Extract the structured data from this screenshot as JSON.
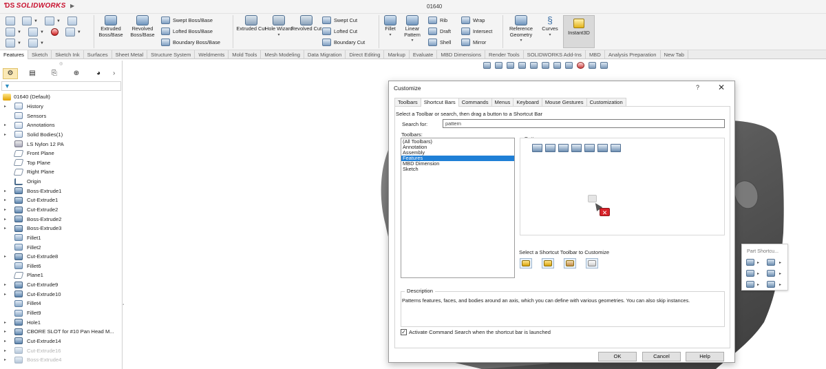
{
  "app": {
    "logo_text": "SOLIDWORKS",
    "doc_title": "01640"
  },
  "cmd": {
    "extruded_boss": "Extruded Boss/Base",
    "revolved_boss": "Revolved Boss/Base",
    "swept_boss": "Swept Boss/Base",
    "lofted_boss": "Lofted Boss/Base",
    "boundary_boss": "Boundary Boss/Base",
    "extruded_cut": "Extruded Cut",
    "hole_wizard": "Hole Wizard",
    "revolved_cut": "Revolved Cut",
    "swept_cut": "Swept Cut",
    "lofted_cut": "Lofted Cut",
    "boundary_cut": "Boundary Cut",
    "fillet": "Fillet",
    "linear_pattern": "Linear Pattern",
    "rib": "Rib",
    "draft": "Draft",
    "shell": "Shell",
    "wrap": "Wrap",
    "intersect": "Intersect",
    "mirror": "Mirror",
    "reference_geometry": "Reference Geometry",
    "curves": "Curves",
    "instant3d": "Instant3D"
  },
  "tabs": [
    "Features",
    "Sketch",
    "Sketch Ink",
    "Surfaces",
    "Sheet Metal",
    "Structure System",
    "Weldments",
    "Mold Tools",
    "Mesh Modeling",
    "Data Migration",
    "Direct Editing",
    "Markup",
    "Evaluate",
    "MBD Dimensions",
    "Render Tools",
    "SOLIDWORKS Add-Ins",
    "MBD",
    "Analysis Preparation",
    "New Tab"
  ],
  "tree": {
    "root": "01640  (Default)",
    "items": [
      {
        "label": "History",
        "icon": "history-icon",
        "exp": true
      },
      {
        "label": "Sensors",
        "icon": "sensor-icon",
        "exp": false
      },
      {
        "label": "Annotations",
        "icon": "annotation-icon",
        "exp": true
      },
      {
        "label": "Solid Bodies(1)",
        "icon": "solid-bodies-icon",
        "exp": true
      },
      {
        "label": "LS Nylon 12 PA",
        "icon": "material-icon",
        "exp": false
      },
      {
        "label": "Front Plane",
        "icon": "plane-icon",
        "exp": false
      },
      {
        "label": "Top Plane",
        "icon": "plane-icon",
        "exp": false
      },
      {
        "label": "Right Plane",
        "icon": "plane-icon",
        "exp": false
      },
      {
        "label": "Origin",
        "icon": "origin-icon",
        "exp": false
      },
      {
        "label": "Boss-Extrude1",
        "icon": "boss-extrude-icon",
        "exp": true
      },
      {
        "label": "Cut-Extrude1",
        "icon": "cut-extrude-icon",
        "exp": true
      },
      {
        "label": "Cut-Extrude2",
        "icon": "cut-extrude-icon",
        "exp": true
      },
      {
        "label": "Boss-Extrude2",
        "icon": "boss-extrude-icon",
        "exp": true
      },
      {
        "label": "Boss-Extrude3",
        "icon": "boss-extrude-icon",
        "exp": true
      },
      {
        "label": "Fillet1",
        "icon": "fillet-icon",
        "exp": false
      },
      {
        "label": "Fillet2",
        "icon": "fillet-icon",
        "exp": false
      },
      {
        "label": "Cut-Extrude8",
        "icon": "cut-extrude-icon",
        "exp": true
      },
      {
        "label": "Fillet6",
        "icon": "fillet-icon",
        "exp": false
      },
      {
        "label": "Plane1",
        "icon": "plane-icon",
        "exp": false
      },
      {
        "label": "Cut-Extrude9",
        "icon": "cut-extrude-icon",
        "exp": true
      },
      {
        "label": "Cut-Extrude10",
        "icon": "cut-extrude-icon",
        "exp": true
      },
      {
        "label": "Fillet4",
        "icon": "fillet-icon",
        "exp": false
      },
      {
        "label": "Fillet9",
        "icon": "fillet-icon",
        "exp": false
      },
      {
        "label": "Hole1",
        "icon": "hole-icon",
        "exp": true
      },
      {
        "label": "CBORE SLOT for #10 Pan Head M...",
        "icon": "hole-icon",
        "exp": true
      },
      {
        "label": "Cut-Extrude14",
        "icon": "cut-extrude-icon",
        "exp": true
      },
      {
        "label": "Cut-Extrude16",
        "icon": "cut-extrude-icon",
        "exp": true,
        "dim": true
      },
      {
        "label": "Boss-Extrude4",
        "icon": "boss-extrude-icon",
        "exp": true,
        "dim": true
      }
    ]
  },
  "shortcut_bar": {
    "title": "Part Shortcu..."
  },
  "dialog": {
    "title": "Customize",
    "help": "?",
    "close": "✕",
    "tabs": [
      "Toolbars",
      "Shortcut Bars",
      "Commands",
      "Menus",
      "Keyboard",
      "Mouse Gestures",
      "Customization"
    ],
    "instruction": "Select a Toolbar or search, then drag a button to a Shortcut Bar",
    "search_label": "Search for:",
    "search_value": "pattern",
    "toolbars_label": "Toolbars:",
    "toolbars": [
      "(All Toolbars)",
      "Annotation",
      "Assembly",
      "Features",
      "MBD Dimension",
      "Sketch"
    ],
    "selected_toolbar": "Features",
    "buttons_label": "Buttons",
    "select_label": "Select a Shortcut Toolbar to Customize",
    "description_label": "Description",
    "description": "Patterns features, faces, and bodies around an axis, which you can define with various geometries. You can also skip instances.",
    "activate_label": "Activate Command Search when the shortcut bar is launched",
    "activate_checked": true,
    "ok": "OK",
    "cancel": "Cancel",
    "help_button": "Help"
  }
}
